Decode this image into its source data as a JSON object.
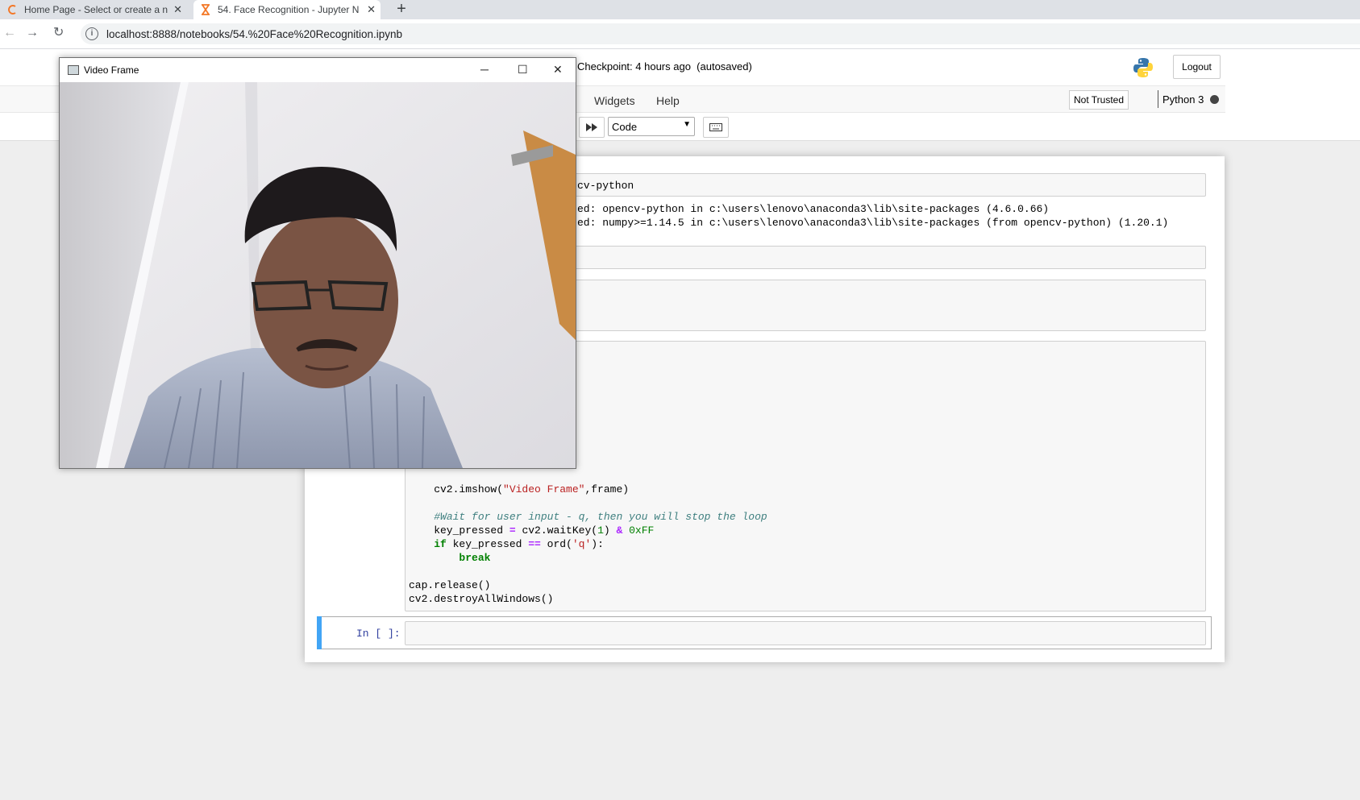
{
  "browser": {
    "tabs": [
      {
        "title": "Home Page - Select or create a n"
      },
      {
        "title": "54. Face Recognition - Jupyter N"
      }
    ],
    "url": "localhost:8888/notebooks/54.%20Face%20Recognition.ipynb"
  },
  "jupyter": {
    "checkpoint": "Checkpoint: 4 hours ago",
    "autosaved": "(autosaved)",
    "logout": "Logout",
    "menu": [
      "Widgets",
      "Help"
    ],
    "not_trusted": "Not Trusted",
    "kernel": "Python 3",
    "cell_type": "Code"
  },
  "notebook": {
    "cell1_input": "cv-python",
    "cell1_output": [
      "ed: opencv-python in c:\\users\\lenovo\\anaconda3\\lib\\site-packages (4.6.0.66)",
      "ed: numpy>=1.14.5 in c:\\users\\lenovo\\anaconda3\\lib\\site-packages (from opencv-python) (1.20.1)"
    ],
    "prompt": "In [ ]:"
  },
  "video_window": {
    "title": "Video Frame"
  },
  "icons": [
    "opencv-logo-icon",
    "hourglass-icon",
    "close-icon",
    "plus-icon",
    "back-arrow-icon",
    "forward-arrow-icon",
    "reload-icon",
    "info-icon",
    "python-logo-icon",
    "fast-forward-icon",
    "keyboard-icon",
    "window-app-icon",
    "minimize-icon",
    "maximize-icon"
  ]
}
